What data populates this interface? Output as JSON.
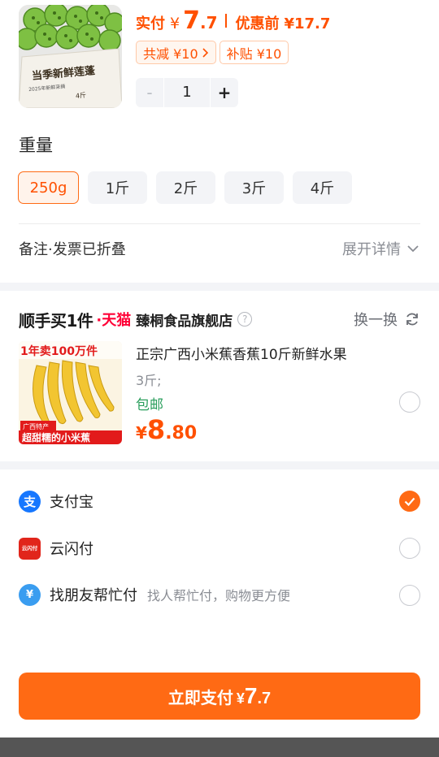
{
  "product": {
    "image_icon": "lotus-seedpods-product-image",
    "image_texts": [
      "当季新鲜莲蓬",
      "2025年新鲜采摘",
      "4斤"
    ],
    "price_label": "实付",
    "currency": "¥",
    "price_int": "7",
    "price_dec": ".7",
    "original_label": "优惠前",
    "original_price": "¥17.7",
    "discount_chip": "共减 ¥10",
    "subsidy_chip": "补贴 ¥10",
    "quantity": "1",
    "minus": "-",
    "plus": "+"
  },
  "weight": {
    "title": "重量",
    "options": [
      "250g",
      "1斤",
      "2斤",
      "3斤",
      "4斤"
    ],
    "selected": "250g"
  },
  "notes": {
    "label": "备注·发票已折叠",
    "expand_label": "展开详情"
  },
  "bundle": {
    "title": "顺手买1件",
    "tmall": "·天猫",
    "store": "臻桐食品旗舰店",
    "help": "?",
    "swap_label": "换一换",
    "image_icon": "mini-banana-product-image",
    "image_texts": [
      "1年卖100万件",
      "广西特产",
      "超甜糯的小米蕉"
    ],
    "name": "正宗广西小米蕉香蕉10斤新鲜水果",
    "spec": "3斤;",
    "shipping": "包邮",
    "currency": "¥",
    "price_int": "8",
    "price_dec": ".80"
  },
  "payment": {
    "methods": [
      {
        "name": "支付宝",
        "sub": "",
        "icon": "alipay-icon",
        "checked": true
      },
      {
        "name": "云闪付",
        "sub": "",
        "icon": "unionpay-quickpass-icon",
        "checked": false
      },
      {
        "name": "找朋友帮忙付",
        "sub": "找人帮忙付，购物更方便",
        "icon": "friend-pay-icon",
        "checked": false
      }
    ],
    "alipay_glyph": "支",
    "unionpay_glyph": "云闪付",
    "friendpay_glyph": "¥"
  },
  "submit": {
    "label": "立即支付",
    "currency": "¥",
    "price_int": "7",
    "price_dec": ".7"
  },
  "colors": {
    "accent": "#ff6a14",
    "price": "#ff5000",
    "tmall": "#ff0036",
    "shipping": "#2a9e5c"
  }
}
